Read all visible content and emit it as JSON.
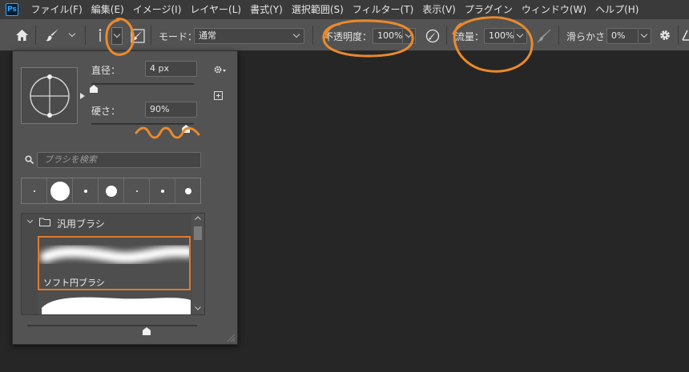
{
  "app": {
    "logo_text": "Ps"
  },
  "menu": [
    "ファイル(F)",
    "編集(E)",
    "イメージ(I)",
    "レイヤー(L)",
    "書式(Y)",
    "選択範囲(S)",
    "フィルター(T)",
    "表示(V)",
    "プラグイン",
    "ウィンドウ(W)",
    "ヘルプ(H)"
  ],
  "options": {
    "mode_label": "モード：",
    "mode_value": "通常",
    "opacity_label": "不透明度：",
    "opacity_value": "100%",
    "flow_label": "流量：",
    "flow_value": "100%",
    "smoothing_label": "滑らかさ：",
    "smoothing_value": "0%"
  },
  "panel": {
    "diameter_label": "直径：",
    "diameter_value": "4 px",
    "diameter_level": 0.0,
    "hardness_label": "硬さ：",
    "hardness_value": "90%",
    "hardness_level": 0.9,
    "search_placeholder": "ブラシを検索",
    "group_name": "汎用ブラシ",
    "selected_brush_name": "ソフト円ブラシ",
    "presets": [
      {
        "size": 2
      },
      {
        "size": 24
      },
      {
        "size": 4
      },
      {
        "size": 14
      },
      {
        "size": 2
      },
      {
        "size": 4
      },
      {
        "size": 8
      }
    ]
  },
  "colors": {
    "annotation": "#e98a2c",
    "selection": "#e07a2a"
  }
}
